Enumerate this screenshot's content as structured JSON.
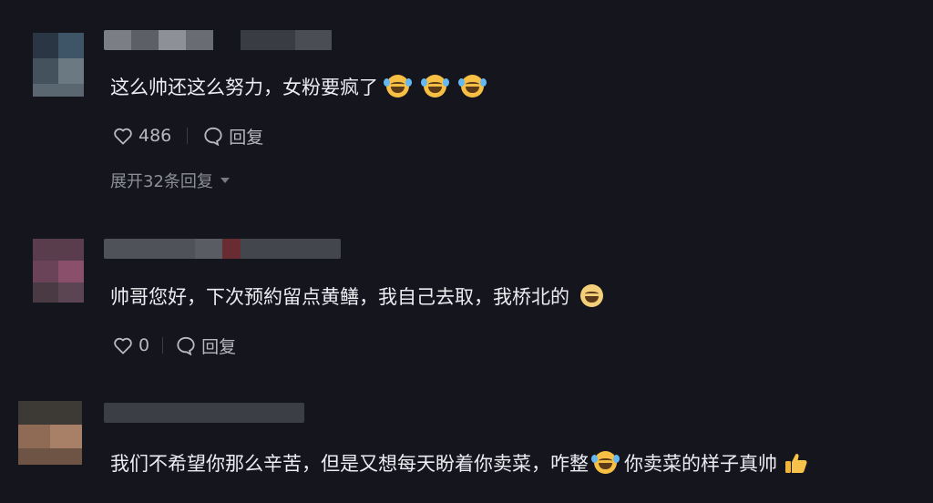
{
  "comments": [
    {
      "text": "这么帅还这么努力，女粉要疯了",
      "likes": "486",
      "reply_label": "回复",
      "expand_label": "展开32条回复",
      "emojis": [
        "laugh-cry-emoji",
        "laugh-cry-emoji",
        "laugh-cry-emoji"
      ]
    },
    {
      "text": "帅哥您好，下次预約留点黄鳝，我自己去取，我桥北的",
      "likes": "0",
      "reply_label": "回复",
      "emojis": [
        "grin-emoji"
      ]
    },
    {
      "text_a": "我们不希望你那么辛苦，但是又想每天盼着你卖菜，咋整",
      "text_b": "你卖菜的样子真帅",
      "emojis": [
        "laugh-cry-emoji",
        "thumbs-up-emoji"
      ]
    }
  ],
  "colors": {
    "background": "#15161d",
    "text": "#ececf1",
    "meta": "#b7b8c0",
    "expand": "#8d8f98"
  },
  "icons": [
    "heart-icon",
    "reply-bubble-icon",
    "chevron-down-icon"
  ]
}
